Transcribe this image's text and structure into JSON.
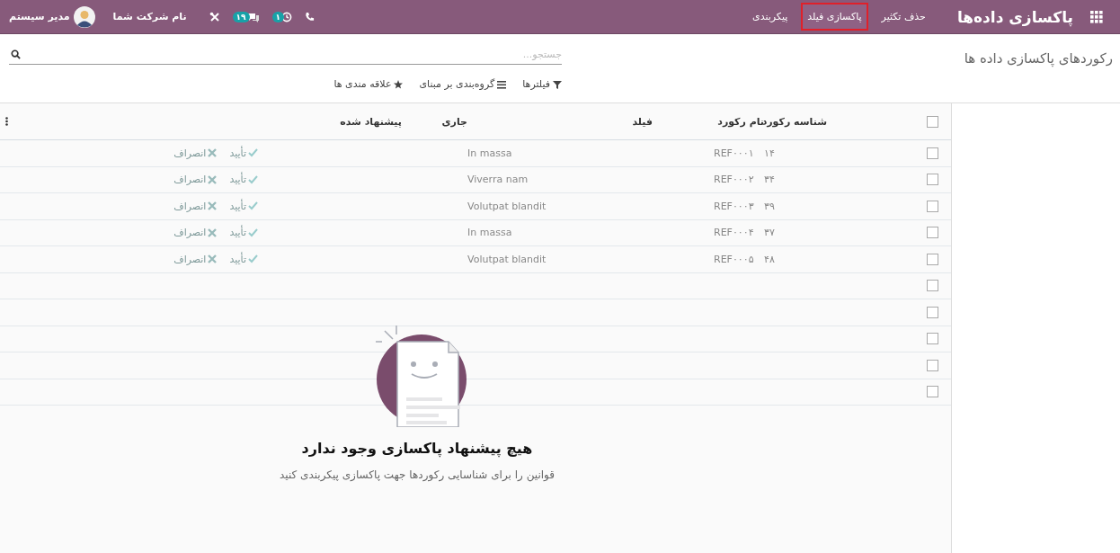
{
  "navbar": {
    "app_title": "پاکسازی داده‌ها",
    "menu": [
      {
        "label": "حذف تکثیر",
        "selected": false
      },
      {
        "label": "پاکسازی فیلد",
        "selected": true
      },
      {
        "label": "پیکربندی",
        "selected": false
      }
    ],
    "activity_badge": "۱",
    "chat_badge": "۱۹",
    "company": "نام شرکت شما",
    "user": "مدیر سیستم"
  },
  "breadcrumb": "رکوردهای پاکسازی داده ها",
  "search": {
    "placeholder": "جستجو..."
  },
  "filters": [
    {
      "kind": "filter",
      "label": "فیلترها"
    },
    {
      "kind": "group",
      "label": "گروه‌بندی بر مبنای"
    },
    {
      "kind": "favorite",
      "label": "علاقه مندی ها"
    }
  ],
  "table": {
    "select_all": {
      "checked": false
    },
    "columns": [
      "شناسه رکورد",
      "نام رکورد",
      "فیلد",
      "جاری",
      "پیشنهاد شده"
    ],
    "rows": [
      {
        "checked": false,
        "id": "۱۴",
        "name": "REF۰۰۰۱",
        "field": "In massa",
        "confirm": "تأیید",
        "cancel": "انصراف"
      },
      {
        "checked": false,
        "id": "۳۴",
        "name": "REF۰۰۰۲",
        "field": "Viverra nam",
        "confirm": "تأیید",
        "cancel": "انصراف"
      },
      {
        "checked": false,
        "id": "۳۹",
        "name": "REF۰۰۰۳",
        "field": "Volutpat blandit",
        "confirm": "تأیید",
        "cancel": "انصراف"
      },
      {
        "checked": false,
        "id": "۳۷",
        "name": "REF۰۰۰۴",
        "field": "In massa",
        "confirm": "تأیید",
        "cancel": "انصراف"
      },
      {
        "checked": false,
        "id": "۴۸",
        "name": "REF۰۰۰۵",
        "field": "Volutpat blandit",
        "confirm": "تأیید",
        "cancel": "انصراف"
      },
      {
        "checked": false
      },
      {
        "checked": false
      },
      {
        "checked": false
      },
      {
        "checked": false
      },
      {
        "checked": false
      }
    ]
  },
  "empty_state": {
    "title": "هیچ پیشنهاد پاکسازی وجود ندارد",
    "text": "قوانین را برای شناسایی رکوردها جهت پاکسازی پیکربندی کنید"
  }
}
